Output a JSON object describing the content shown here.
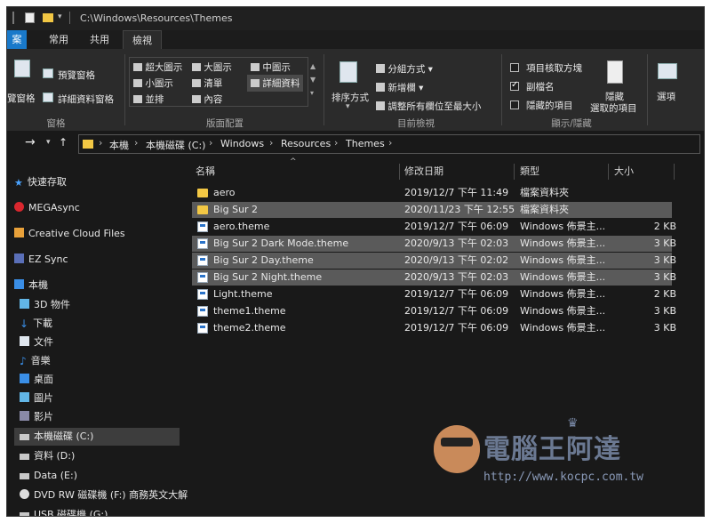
{
  "window": {
    "title_path": "C:\\Windows\\Resources\\Themes"
  },
  "ribbon_tabs": [
    {
      "label": "案"
    },
    {
      "label": "常用"
    },
    {
      "label": "共用"
    },
    {
      "label": "檢視"
    }
  ],
  "ribbon": {
    "panes": {
      "navigation_pane_label": "覽窗格",
      "preview_pane_label": "預覽窗格",
      "details_pane_label": "詳細資料窗格",
      "group_label": "窗格"
    },
    "layout": {
      "items": [
        "超大圖示",
        "大圖示",
        "中圖示",
        "小圖示",
        "清單",
        "詳細資料",
        "並排",
        "內容"
      ],
      "group_label": "版面配置"
    },
    "current_view": {
      "sort_label": "排序方式",
      "group_by_label": "分組方式",
      "add_columns_label": "新增欄",
      "size_columns_label": "調整所有欄位至最大小",
      "group_label": "目前檢視"
    },
    "show_hide": {
      "item_checkboxes_label": "項目核取方塊",
      "extensions_label": "副檔名",
      "hidden_items_label": "隱藏的項目",
      "hide_selected_label_1": "隱藏",
      "hide_selected_label_2": "選取的項目",
      "options_label": "選項",
      "group_label": "顯示/隱藏",
      "item_checkboxes_checked": false,
      "extensions_checked": true,
      "hidden_items_checked": false
    }
  },
  "address_bar": {
    "crumbs": [
      "本機",
      "本機磁碟 (C:)",
      "Windows",
      "Resources",
      "Themes"
    ]
  },
  "sidebar": {
    "items": [
      {
        "label": "快速存取",
        "icon": "star-icon"
      },
      {
        "label": "MEGAsync",
        "icon": "mega-icon"
      },
      {
        "label": "Creative Cloud Files",
        "icon": "creative-cloud-icon"
      },
      {
        "label": "EZ Sync",
        "icon": "ez-sync-icon"
      },
      {
        "label": "本機",
        "icon": "computer-icon"
      },
      {
        "label": "3D 物件",
        "icon": "cube-icon"
      },
      {
        "label": "下載",
        "icon": "download-icon"
      },
      {
        "label": "文件",
        "icon": "document-icon"
      },
      {
        "label": "音樂",
        "icon": "music-icon"
      },
      {
        "label": "桌面",
        "icon": "desktop-icon"
      },
      {
        "label": "圖片",
        "icon": "picture-icon"
      },
      {
        "label": "影片",
        "icon": "video-icon"
      },
      {
        "label": "本機磁碟 (C:)",
        "icon": "drive-icon"
      },
      {
        "label": "資料 (D:)",
        "icon": "drive-icon"
      },
      {
        "label": "Data (E:)",
        "icon": "drive-icon"
      },
      {
        "label": "DVD RW 磁碟機 (F:) 商務英文大解",
        "icon": "dvd-icon"
      },
      {
        "label": "USB 磁碟機 (G:)",
        "icon": "usb-icon"
      }
    ]
  },
  "file_list": {
    "columns": [
      "名稱",
      "修改日期",
      "類型",
      "大小"
    ],
    "rows": [
      {
        "name": "aero",
        "date": "2019/12/7 下午 11:49",
        "type": "檔案資料夾",
        "size": "",
        "kind": "folder",
        "selected": false
      },
      {
        "name": "Big Sur 2",
        "date": "2020/11/23 下午 12:55",
        "type": "檔案資料夾",
        "size": "",
        "kind": "folder",
        "selected": true
      },
      {
        "name": "aero.theme",
        "date": "2019/12/7 下午 06:09",
        "type": "Windows 佈景主...",
        "size": "2 KB",
        "kind": "theme",
        "selected": false
      },
      {
        "name": "Big Sur 2 Dark Mode.theme",
        "date": "2020/9/13 下午 02:03",
        "type": "Windows 佈景主...",
        "size": "3 KB",
        "kind": "theme",
        "selected": true
      },
      {
        "name": "Big Sur 2 Day.theme",
        "date": "2020/9/13 下午 02:02",
        "type": "Windows 佈景主...",
        "size": "3 KB",
        "kind": "theme",
        "selected": true
      },
      {
        "name": "Big Sur 2 Night.theme",
        "date": "2020/9/13 下午 02:03",
        "type": "Windows 佈景主...",
        "size": "3 KB",
        "kind": "theme",
        "selected": true
      },
      {
        "name": "Light.theme",
        "date": "2019/12/7 下午 06:09",
        "type": "Windows 佈景主...",
        "size": "2 KB",
        "kind": "theme",
        "selected": false
      },
      {
        "name": "theme1.theme",
        "date": "2019/12/7 下午 06:09",
        "type": "Windows 佈景主...",
        "size": "3 KB",
        "kind": "theme",
        "selected": false
      },
      {
        "name": "theme2.theme",
        "date": "2019/12/7 下午 06:09",
        "type": "Windows 佈景主...",
        "size": "3 KB",
        "kind": "theme",
        "selected": false
      }
    ]
  },
  "watermark": {
    "title": "電腦王阿達",
    "url": "http://www.kocpc.com.tw"
  },
  "colors": {
    "file_tab": "#1979ca",
    "selection": "#5a5a5a",
    "folder": "#f2c744"
  }
}
